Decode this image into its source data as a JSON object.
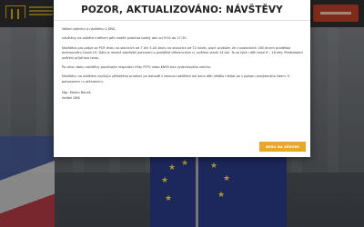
{
  "modal": {
    "title": "POZOR, AKTUALIZOVÁNO: NÁVŠTĚVY",
    "paragraphs": [
      "Vážení zájemci o návštěvu v DNS,",
      "návštěvy na oddělení během pěti nedělí probíhat každý den od 9:00 do 17:30.",
      "Návštěva pro pobyt za PCR testu na stanicích od 7 dní 3 AG testu na stanicích od 72 hodin, popř. prokáže, že v posledních 180 dnech prodělala onemocnění Covid-19. Dále je možné předložit potvrzení o proběhlé diferenciální ci, ověření starší 14 dní. To se týká i děti mezi 6 – 18 lety. Předkládání ověření přijdí bez testu.",
      "Po celou dobu návštěvy používejte respirátor třídy FFP2 nebo KN95 bez výdechového ventilu.",
      "Návštěvu na oddělení zvyšující pětiletého prodlení po dohodě s vedoucí oddělení lok ázno děti vědělo hlédat po s pokojin ozejstenáho lidem. S pohovorem i z otčerenimi."
    ],
    "signature": {
      "name": "Mgr. Martin Beneš",
      "role": "ředitel DNS"
    },
    "button_label": "BERU NA VĚDOMÍ"
  },
  "background": {
    "nav_button_label": "",
    "colors": {
      "accent": "#e8a72c",
      "nav_button": "#a83a24",
      "logo": "#c99a1e",
      "eu_blue": "#26347a",
      "eu_star": "#e4c63a"
    }
  }
}
